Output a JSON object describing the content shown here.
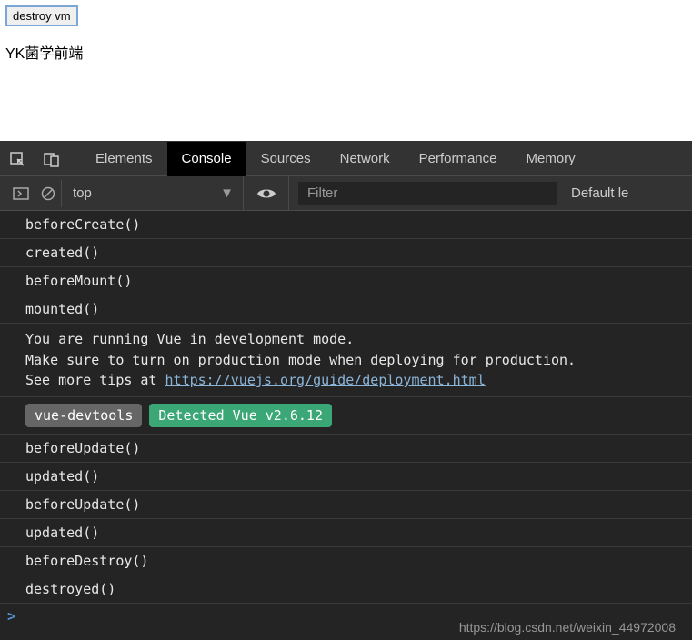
{
  "page": {
    "button_label": "destroy vm",
    "body_text": "YK菌学前端"
  },
  "devtools": {
    "tabs": {
      "elements": "Elements",
      "console": "Console",
      "sources": "Sources",
      "network": "Network",
      "performance": "Performance",
      "memory": "Memory"
    },
    "toolbar": {
      "context": "top",
      "filter_placeholder": "Filter",
      "level": "Default le"
    },
    "logs": [
      "beforeCreate()",
      "created()",
      "beforeMount()",
      "mounted()"
    ],
    "vue_warning": {
      "line1": "You are running Vue in development mode.",
      "line2": "Make sure to turn on production mode when deploying for production.",
      "line3_prefix": "See more tips at ",
      "line3_link": "https://vuejs.org/guide/deployment.html"
    },
    "vue_devtools": {
      "label": "vue-devtools",
      "detected": "Detected Vue v2.6.12"
    },
    "logs2": [
      "beforeUpdate()",
      "updated()",
      "beforeUpdate()",
      "updated()",
      "beforeDestroy()",
      "destroyed()"
    ],
    "prompt": ">"
  },
  "watermark": "https://blog.csdn.net/weixin_44972008"
}
